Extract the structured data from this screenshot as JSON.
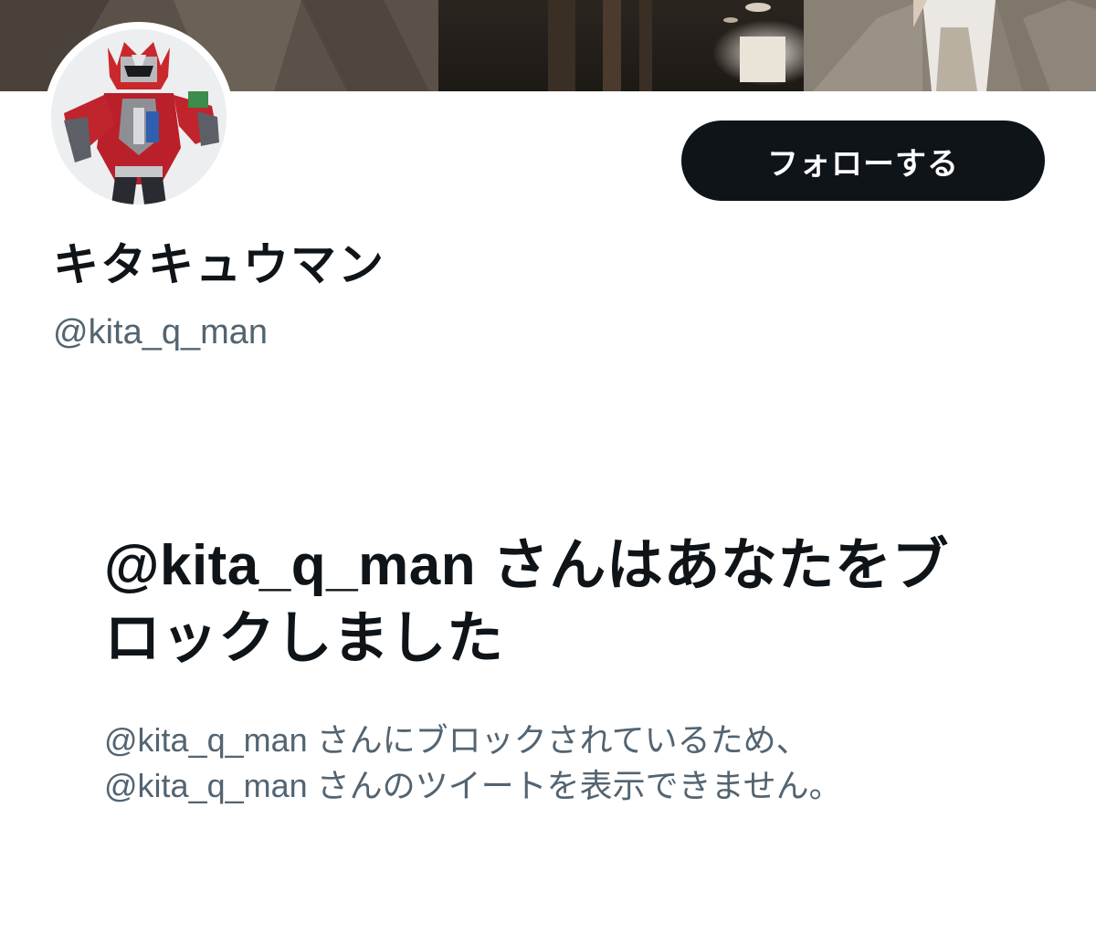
{
  "banner": {
    "image_description_icon": "profile-banner-photo"
  },
  "avatar": {
    "icon": "avatar-photo"
  },
  "follow_button": {
    "label": "フォローする"
  },
  "profile": {
    "display_name": "キタキュウマン",
    "handle": "@kita_q_man"
  },
  "blocked_notice": {
    "title": "@kita_q_man さんはあなたをブロックしました",
    "description_line1": "@kita_q_man さんにブロックされているため、",
    "description_line2": "@kita_q_man さんのツイートを表示できません。"
  },
  "colors": {
    "primary_text": "#0f1419",
    "secondary_text": "#536471",
    "button_bg": "#0f1419",
    "button_text": "#ffffff",
    "background": "#ffffff"
  }
}
